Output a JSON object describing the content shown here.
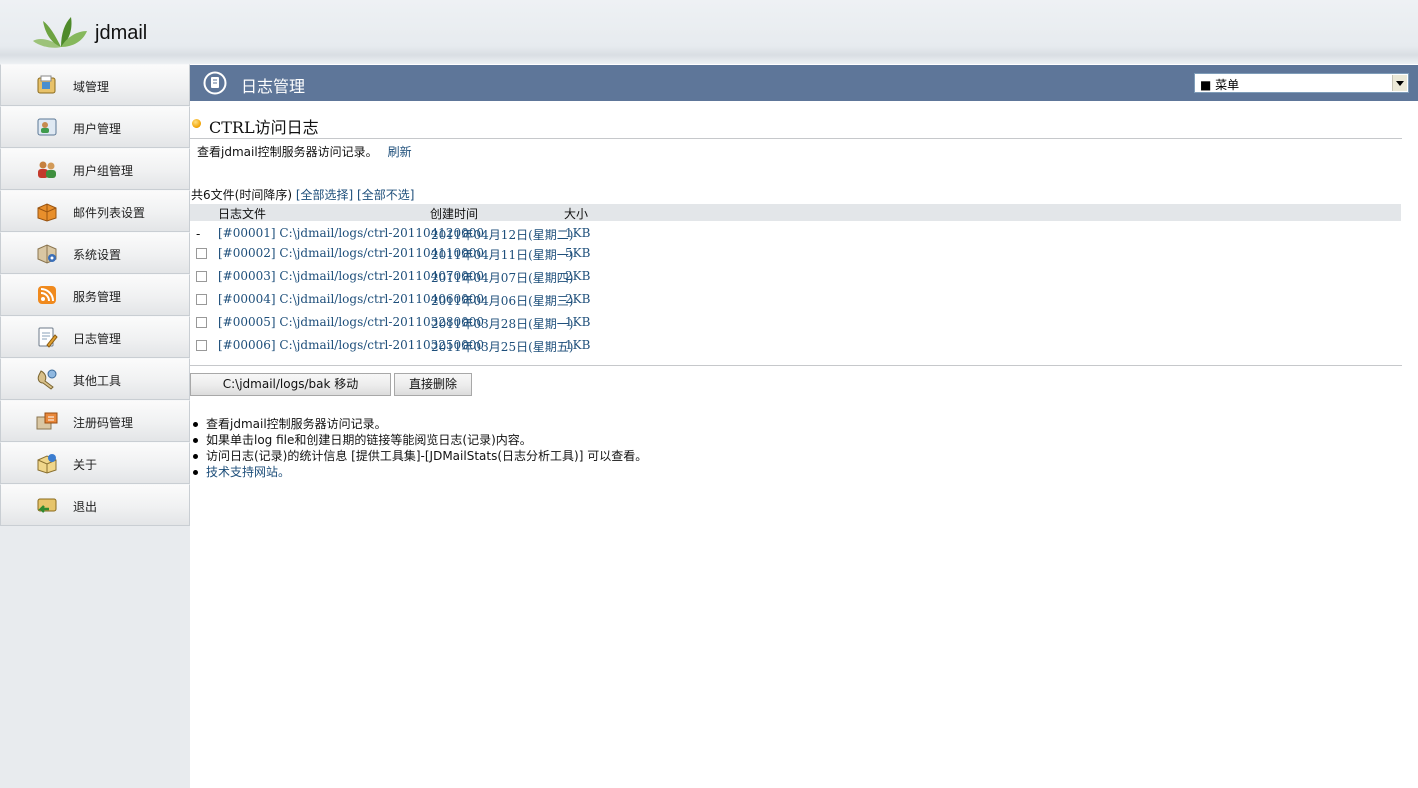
{
  "header": {
    "logo_text": "jdmail"
  },
  "sidebar": {
    "items": [
      {
        "label": "域管理",
        "icon": "domain-icon"
      },
      {
        "label": "用户管理",
        "icon": "user-icon"
      },
      {
        "label": "用户组管理",
        "icon": "user-group-icon"
      },
      {
        "label": "邮件列表设置",
        "icon": "mailing-list-icon"
      },
      {
        "label": "系统设置",
        "icon": "system-settings-icon"
      },
      {
        "label": "服务管理",
        "icon": "service-icon"
      },
      {
        "label": "日志管理",
        "icon": "log-icon"
      },
      {
        "label": "其他工具",
        "icon": "tools-icon"
      },
      {
        "label": "注册码管理",
        "icon": "license-icon"
      },
      {
        "label": "关于",
        "icon": "about-icon"
      },
      {
        "label": "退出",
        "icon": "logout-icon"
      }
    ]
  },
  "main": {
    "title": "日志管理",
    "menu_select": {
      "value": "■ 菜单"
    },
    "section_title": "CTRL访问日志",
    "description": "查看jdmail控制服务器访问记录。",
    "refresh_label": "刷新",
    "summary": {
      "prefix": "共6文件(时间降序)",
      "select_all": "[全部选择]",
      "deselect_all": "[全部不选]"
    },
    "table": {
      "columns": [
        "日志文件",
        "创建时间",
        "大小"
      ],
      "rows": [
        {
          "marker": "-",
          "file": "[#00001] C:\\jdmail/logs/ctrl-201104120000",
          "date": "2011年04月12日(星期二)",
          "size": "1KB"
        },
        {
          "marker": "",
          "file": "[#00002] C:\\jdmail/logs/ctrl-201104110000",
          "date": "2011年04月11日(星期一)",
          "size": "5KB"
        },
        {
          "marker": "",
          "file": "[#00003] C:\\jdmail/logs/ctrl-201104070000",
          "date": "2011年04月07日(星期四)",
          "size": "2KB"
        },
        {
          "marker": "",
          "file": "[#00004] C:\\jdmail/logs/ctrl-201104060000",
          "date": "2011年04月06日(星期三)",
          "size": "2KB"
        },
        {
          "marker": "",
          "file": "[#00005] C:\\jdmail/logs/ctrl-201103280000",
          "date": "2011年03月28日(星期一)",
          "size": "1KB"
        },
        {
          "marker": "",
          "file": "[#00006] C:\\jdmail/logs/ctrl-201103250000",
          "date": "2011年03月25日(星期五)",
          "size": "1KB"
        }
      ]
    },
    "buttons": {
      "move": "C:\\jdmail/logs/bak 移动",
      "delete": "直接删除"
    },
    "notes": [
      "查看jdmail控制服务器访问记录。",
      "如果单击log file和创建日期的链接等能阅览日志(记录)内容。",
      "访问日志(记录)的统计信息 [提供工具集]-[JDMailStats(日志分析工具)] 可以查看。"
    ],
    "support_link": "技术支持网站。"
  },
  "colors": {
    "title_bar": "#5e7699",
    "link": "#1d4e7a",
    "sidebar_bg": "#e8ebee",
    "table_header_bg": "#e3e6e9"
  }
}
